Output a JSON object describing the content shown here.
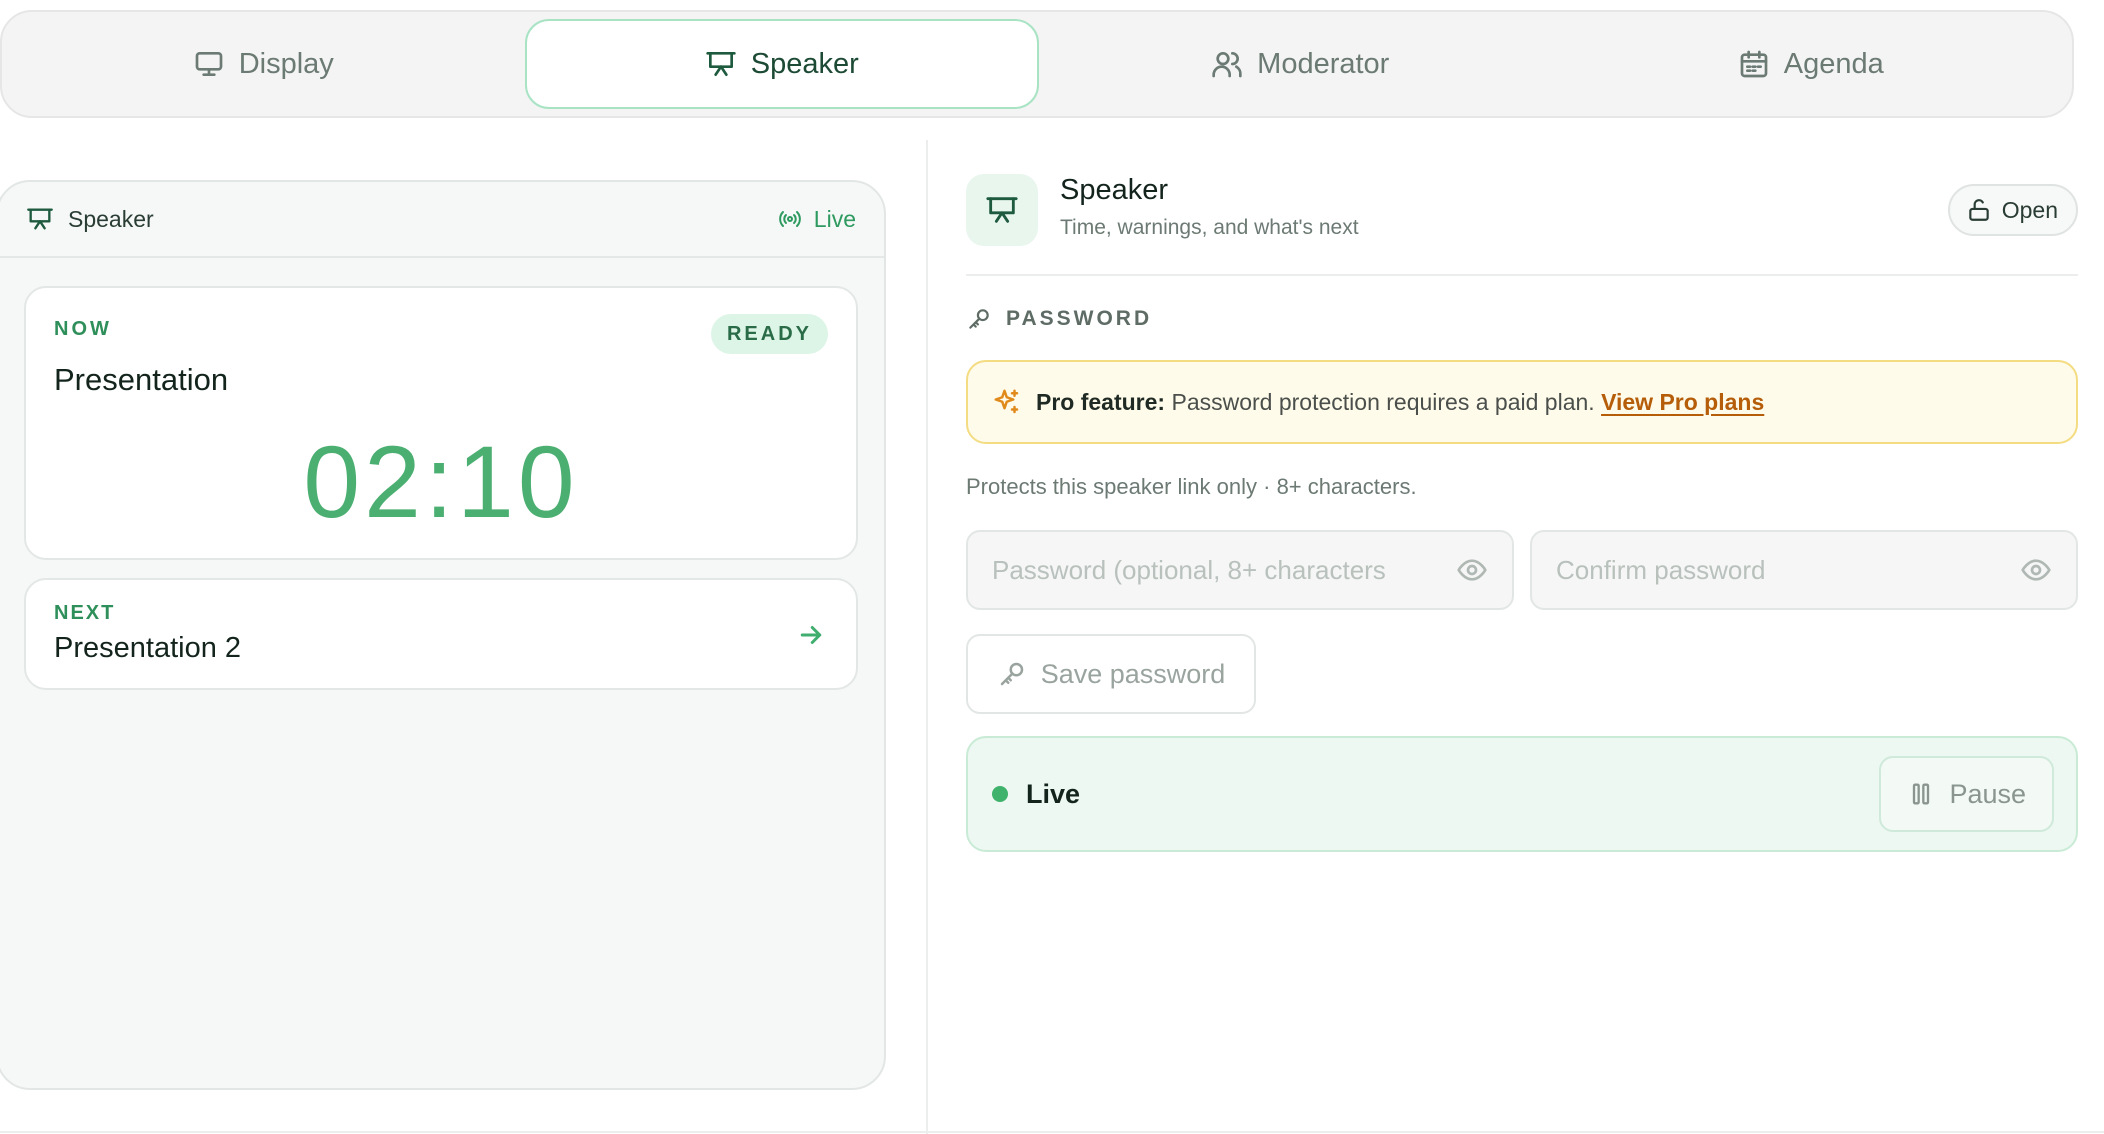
{
  "tabs": [
    {
      "label": "Display",
      "icon": "monitor-icon",
      "active": false
    },
    {
      "label": "Speaker",
      "icon": "presentation-icon",
      "active": true
    },
    {
      "label": "Moderator",
      "icon": "users-icon",
      "active": false
    },
    {
      "label": "Agenda",
      "icon": "calendar-icon",
      "active": false
    }
  ],
  "preview": {
    "title": "Speaker",
    "status": "Live",
    "now": {
      "label": "NOW",
      "badge": "READY",
      "title": "Presentation",
      "timer": "02:10"
    },
    "next": {
      "label": "NEXT",
      "title": "Presentation 2"
    }
  },
  "settings": {
    "title": "Speaker",
    "subtitle": "Time, warnings, and what's next",
    "open_label": "Open",
    "password_section": "PASSWORD",
    "pro_banner": {
      "strong": "Pro feature:",
      "text": " Password protection requires a paid plan. ",
      "link": "View Pro plans"
    },
    "protect_note": "Protects this speaker link only · 8+ characters.",
    "password_placeholder": "Password (optional, 8+ characters",
    "confirm_placeholder": "Confirm password",
    "save_label": "Save password",
    "live_label": "Live",
    "pause_label": "Pause"
  },
  "colors": {
    "accent": "#4caf72",
    "accent_dark": "#1d5a3e",
    "live_dot": "#3fb26b",
    "pro_link": "#b55d09"
  }
}
